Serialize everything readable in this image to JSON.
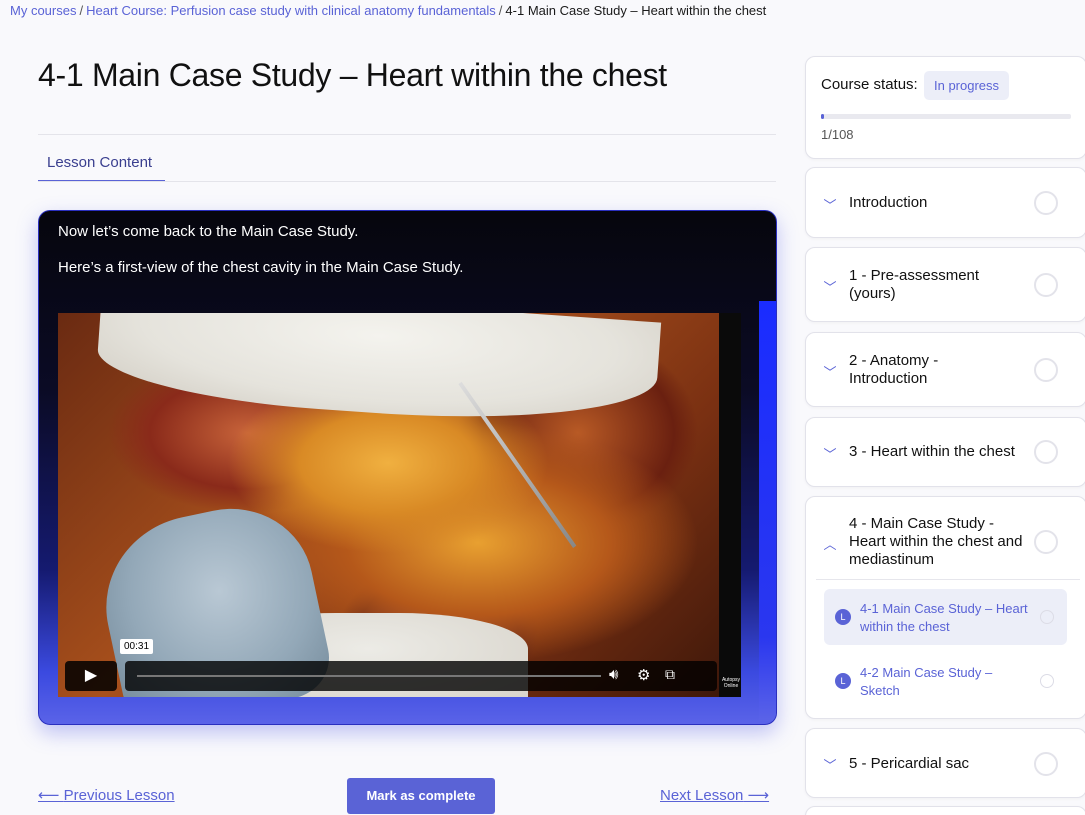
{
  "breadcrumb": {
    "item1": "My courses",
    "item2": "Heart Course: Perfusion case study with clinical anatomy fundamentals",
    "current": "4-1 Main Case Study – Heart within the chest",
    "sep": "/"
  },
  "page": {
    "title": "4-1 Main Case Study – Heart within the chest",
    "tab": "Lesson Content"
  },
  "content": {
    "paragraph1": "Now let’s come back to the Main Case Study.",
    "paragraph2": "Here’s a first-view of the chest cavity in the Main Case Study.",
    "video": {
      "time": "00:31",
      "watermark": "Autopsy Online",
      "progress": 0
    }
  },
  "nav": {
    "prev": "Previous Lesson",
    "mark": "Mark as complete",
    "next": "Next Lesson"
  },
  "status": {
    "label": "Course status:",
    "badge": "In progress",
    "count": "1/108",
    "progress": 0.009
  },
  "sections": [
    {
      "title": "Introduction",
      "chevron": "down"
    },
    {
      "title": "1 - Pre-assessment (yours)",
      "chevron": "down"
    },
    {
      "title": "2 - Anatomy - Introduction",
      "chevron": "down"
    },
    {
      "title": "3 - Heart within the chest",
      "chevron": "down"
    },
    {
      "title": "4 - Main Case Study - Heart within the chest and mediastinum",
      "chevron": "up",
      "lessons": [
        {
          "badge": "L",
          "title": "4-1 Main Case Study – Heart within the chest",
          "active": true
        },
        {
          "badge": "L",
          "title": "4-2 Main Case Study – Sketch",
          "active": false
        }
      ]
    },
    {
      "title": "5 - Pericardial sac",
      "chevron": "down"
    }
  ],
  "colors": {
    "accent": "#5a63d6",
    "video_bg_bottom": "#5a63e8"
  }
}
